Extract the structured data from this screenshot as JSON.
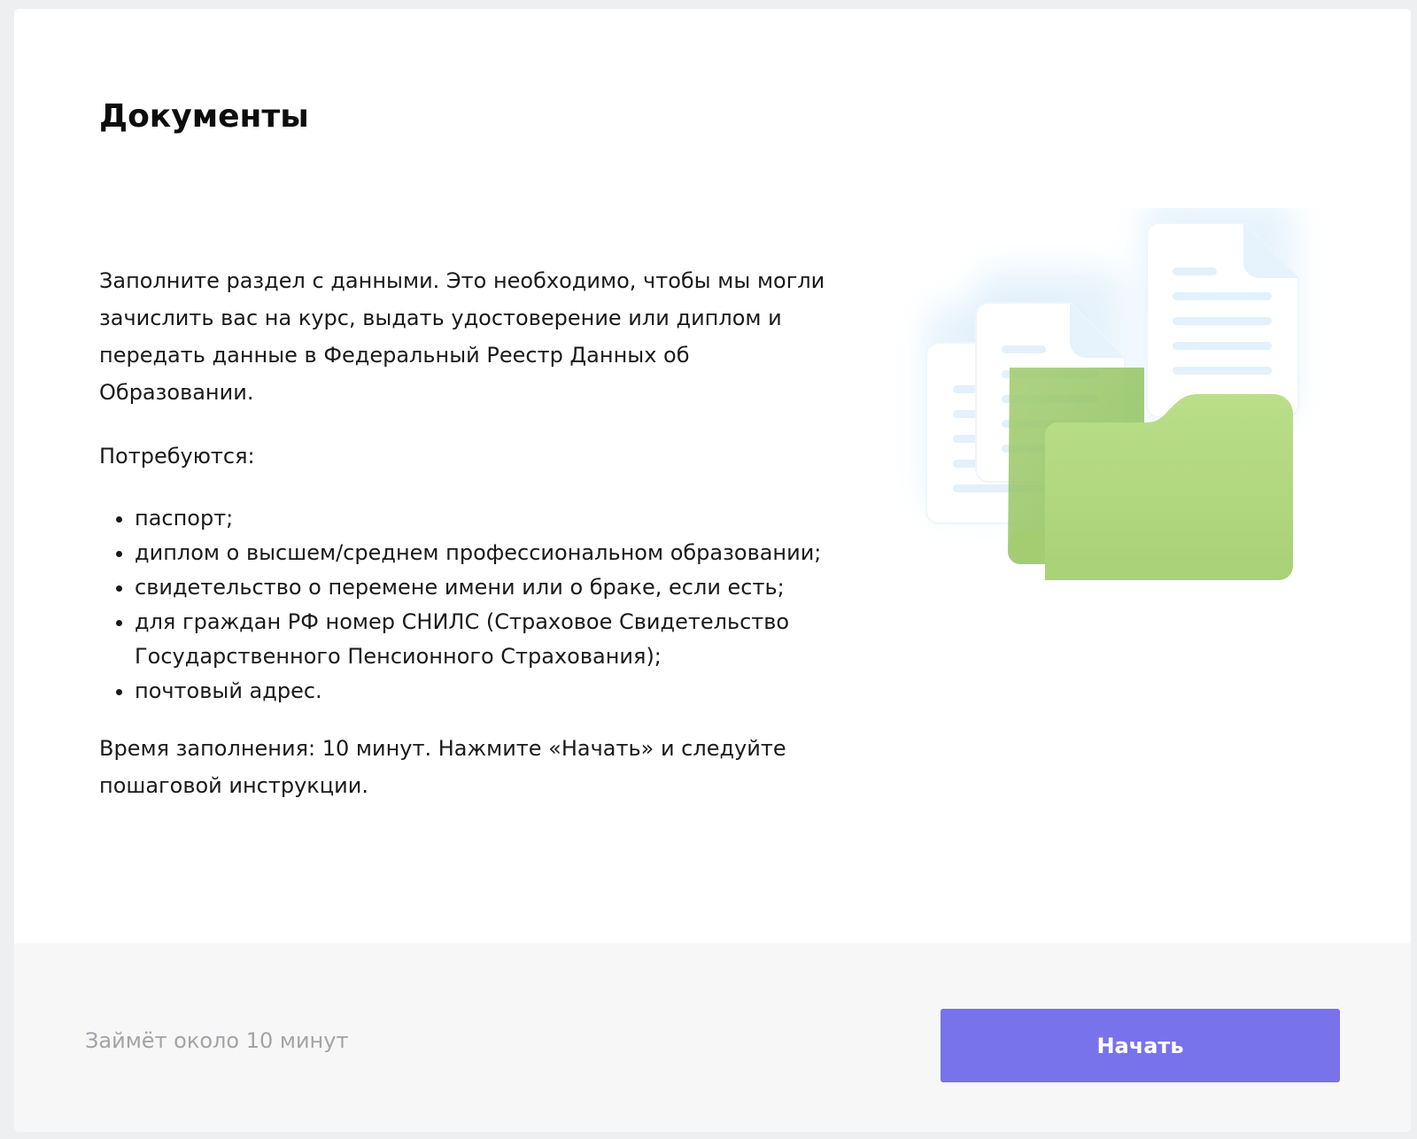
{
  "page": {
    "title": "Документы"
  },
  "intro": {
    "description": "Заполните раздел с данными. Это необходимо, чтобы мы могли зачислить вас на курс, выдать удостоверение или диплом и передать данные в Федеральный Реестр Данных об Образовании.",
    "requirements_heading": "Потребуются:",
    "requirements": [
      "паспорт;",
      "диплом о высшем/среднем профессиональном образовании;",
      "свидетельство о перемене имени или о браке, если есть;",
      "для граждан РФ номер СНИЛС (Страховое Свидетельство Государственного Пенсионного Страхования);",
      "почтовый адрес."
    ],
    "time_note": "Время заполнения: 10 минут. Нажмите «Начать» и следуйте пошаговой инструкции."
  },
  "illustration": {
    "icon": "documents-folder-icon",
    "colors": {
      "folder_front": "#b7dc85",
      "folder_back": "#a3cd70",
      "paper": "#ffffff",
      "paper_lines": "#e2f1fb",
      "glow": "#e3f2fc"
    }
  },
  "footer": {
    "duration_label": "Займёт около 10 минут",
    "start_label": "Начать"
  },
  "colors": {
    "accent": "#7872eb",
    "footer_bg": "#f7f7f8",
    "muted_text": "#a3a3a8"
  }
}
